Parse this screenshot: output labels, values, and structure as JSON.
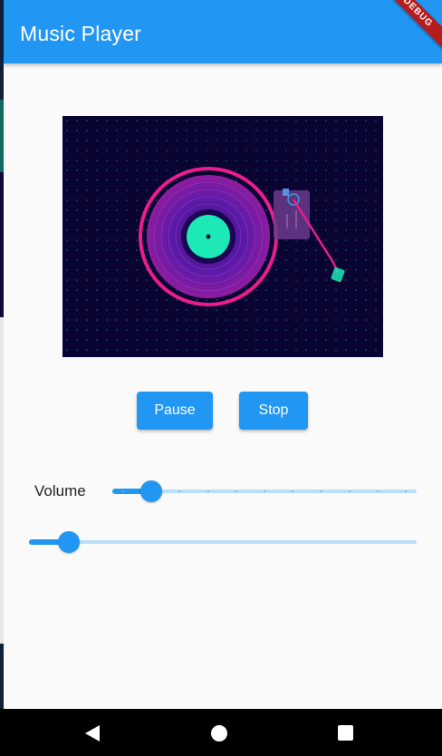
{
  "app": {
    "title": "Music Player",
    "debug_banner": "DEBUG"
  },
  "artwork": {
    "icon": "turntable-illustration"
  },
  "controls": {
    "pause_label": "Pause",
    "stop_label": "Stop"
  },
  "volume": {
    "label": "Volume",
    "value": 0.1,
    "divisions": 10
  },
  "seek": {
    "value": 0.08
  },
  "colors": {
    "primary": "#2196f3",
    "track": "#bbdefb",
    "art_bg": "#0a0433",
    "record_ring": "#e91e8c",
    "label": "#1de9b6"
  },
  "navbar": {
    "back_icon": "back-triangle-icon",
    "home_icon": "home-circle-icon",
    "recents_icon": "recents-square-icon"
  }
}
